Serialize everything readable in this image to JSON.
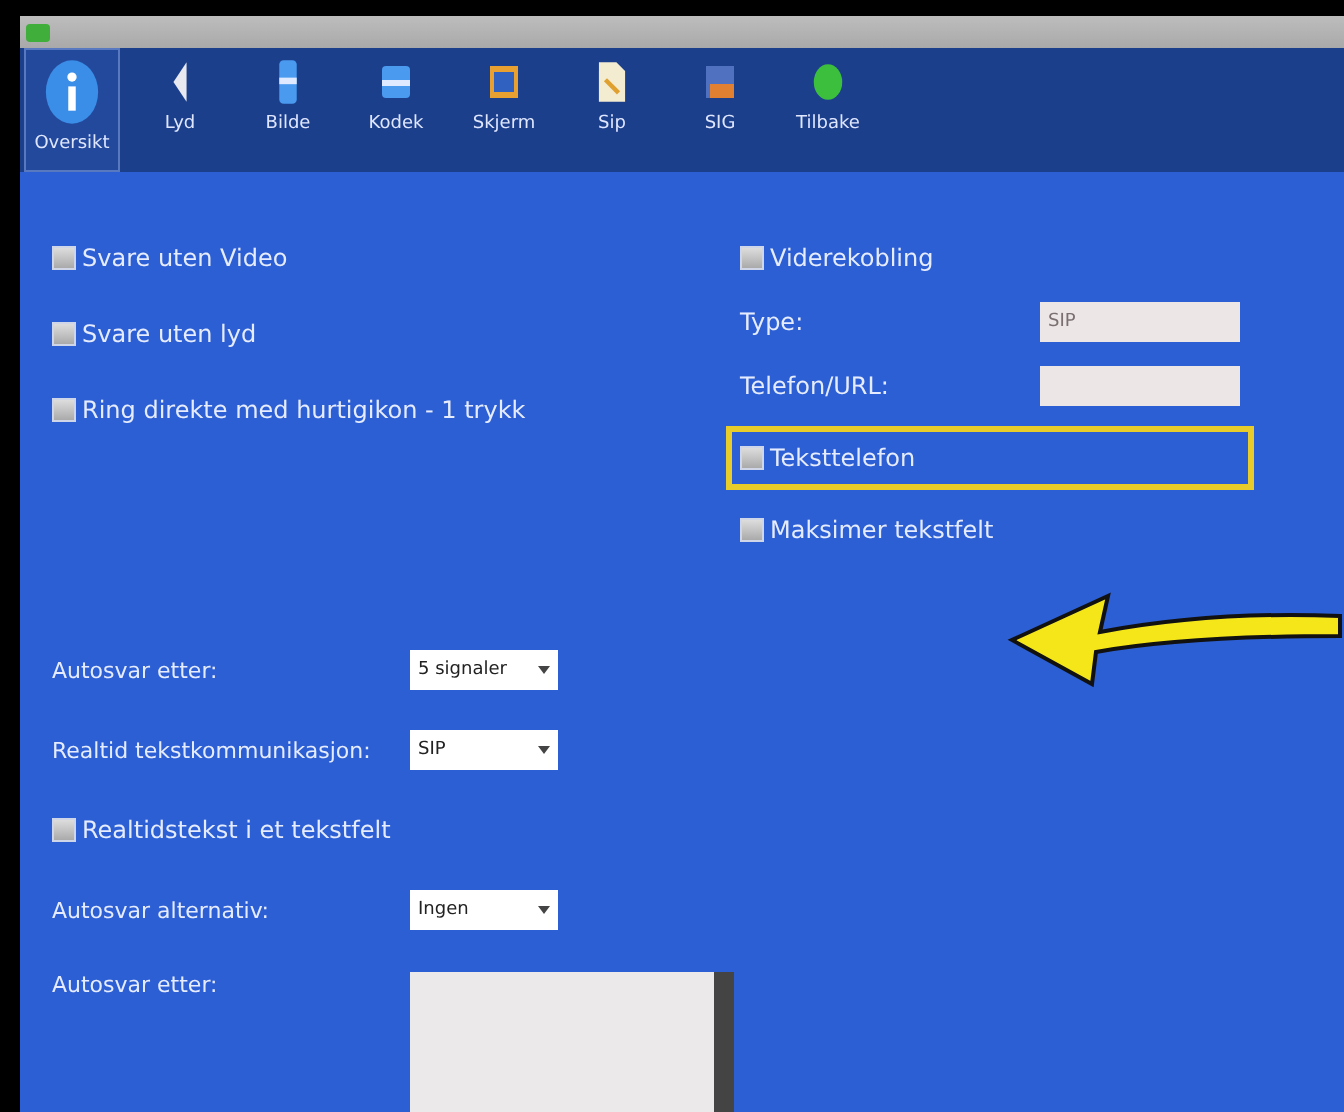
{
  "toolbar": [
    {
      "label": "Oversikt",
      "selected": true
    },
    {
      "label": "Lyd",
      "selected": false
    },
    {
      "label": "Bilde",
      "selected": false
    },
    {
      "label": "Kodek",
      "selected": false
    },
    {
      "label": "Skjerm",
      "selected": false
    },
    {
      "label": "Sip",
      "selected": false
    },
    {
      "label": "SIG",
      "selected": false
    },
    {
      "label": "Tilbake",
      "selected": false
    }
  ],
  "left_options": [
    {
      "label": "Svare uten Video",
      "checked": false
    },
    {
      "label": "Svare uten lyd",
      "checked": false
    },
    {
      "label": "Ring direkte med hurtigikon - 1 trykk",
      "checked": false
    }
  ],
  "right_section": [
    {
      "kind": "checkbox",
      "label": "Viderekobling",
      "checked": false
    },
    {
      "kind": "field",
      "label": "Type:",
      "value": "SIP"
    },
    {
      "kind": "field",
      "label": "Telefon/URL:"
    },
    {
      "kind": "checkbox",
      "label": "Teksttelefon",
      "checked": false,
      "highlighted": true
    },
    {
      "kind": "checkbox",
      "label": "Maksimer tekstfelt",
      "checked": false
    }
  ],
  "lower_section": [
    {
      "kind": "dropdown",
      "label": "Autosvar etter:",
      "value": "5 signaler"
    },
    {
      "kind": "dropdown",
      "label": "Realtid tekstkommunikasjon:",
      "value": "SIP"
    },
    {
      "kind": "checkbox",
      "label": "Realtidstekst i et tekstfelt",
      "checked": false
    },
    {
      "kind": "dropdown",
      "label": "Autosvar alternativ:",
      "value": "Ingen"
    },
    {
      "kind": "textarea",
      "label": "Autosvar etter:"
    }
  ]
}
